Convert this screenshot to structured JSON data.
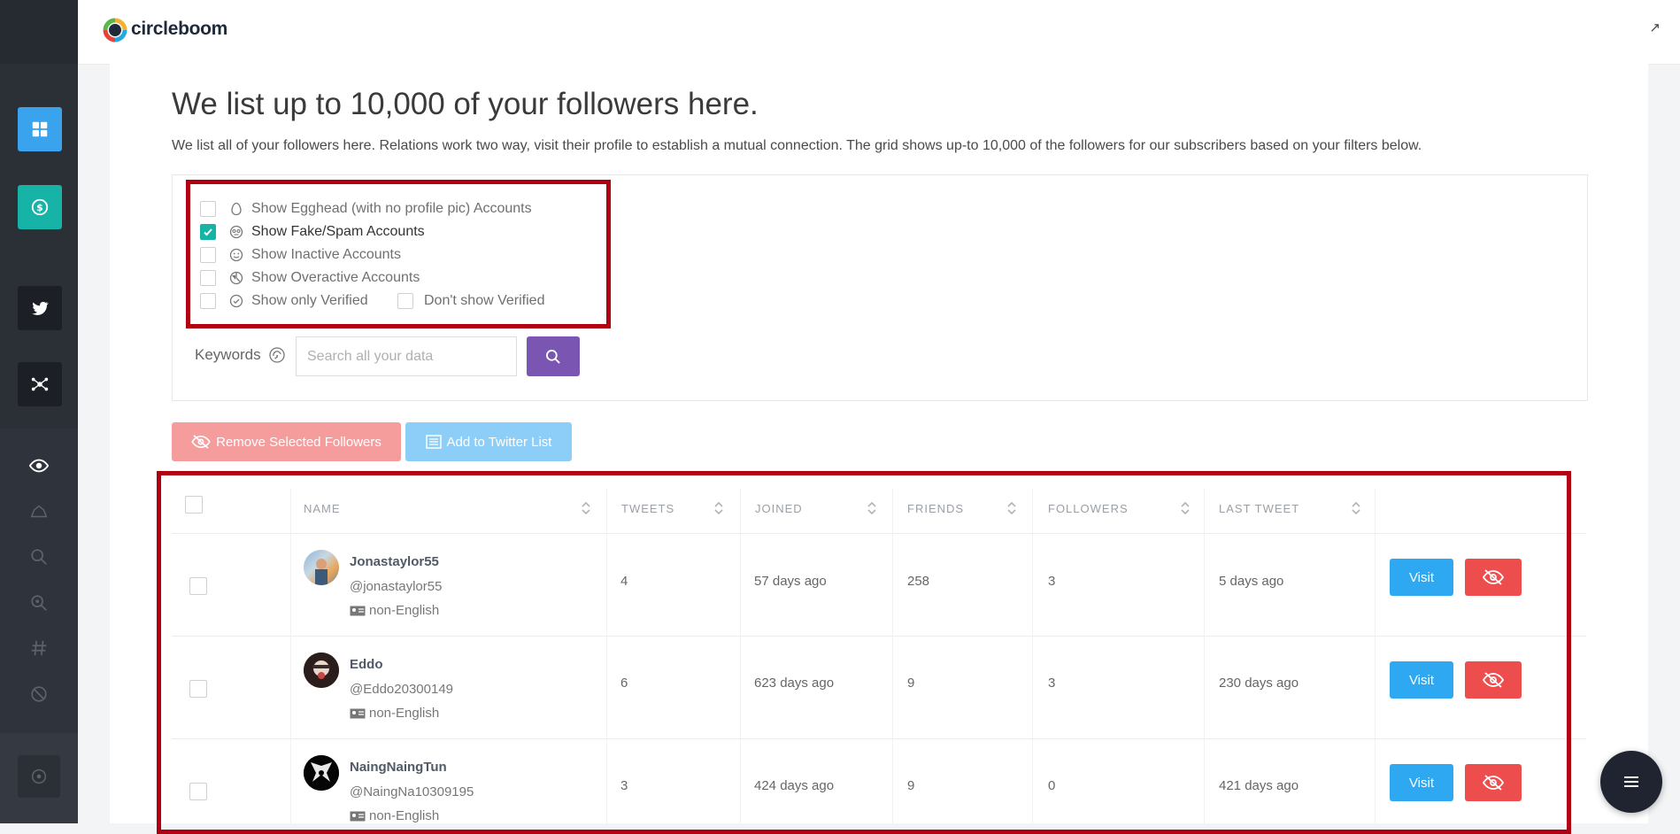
{
  "brand": {
    "logo_text": "circleboom"
  },
  "page": {
    "title": "We list up to 10,000 of your followers here.",
    "subtitle": "We list all of your followers here. Relations work two way, visit their profile to establish a mutual connection. The grid shows up-to 10,000 of the followers for our subscribers based on your filters below."
  },
  "filters": {
    "egghead": {
      "label": "Show Egghead (with no profile pic) Accounts",
      "checked": false
    },
    "fake_spam": {
      "label": "Show Fake/Spam Accounts",
      "checked": true
    },
    "inactive": {
      "label": "Show Inactive Accounts",
      "checked": false
    },
    "overactive": {
      "label": "Show Overactive Accounts",
      "checked": false
    },
    "only_verified": {
      "label": "Show only Verified",
      "checked": false
    },
    "dont_verified": {
      "label": "Don't show Verified",
      "checked": false
    }
  },
  "search": {
    "label": "Keywords",
    "placeholder": "Search all your data"
  },
  "actions": {
    "remove_label": "Remove Selected Followers",
    "add_list_label": "Add to Twitter List"
  },
  "table": {
    "columns": [
      "NAME",
      "TWEETS",
      "JOINED",
      "FRIENDS",
      "FOLLOWERS",
      "LAST TWEET"
    ],
    "rows": [
      {
        "name": "Jonastaylor55",
        "handle": "@jonastaylor55",
        "lang": "non-English",
        "tweets": "4",
        "joined": "57 days ago",
        "friends": "258",
        "followers": "3",
        "last_tweet": "5 days ago",
        "visit": "Visit"
      },
      {
        "name": "Eddo",
        "handle": "@Eddo20300149",
        "lang": "non-English",
        "tweets": "6",
        "joined": "623 days ago",
        "friends": "9",
        "followers": "3",
        "last_tweet": "230 days ago",
        "visit": "Visit"
      },
      {
        "name": "NaingNaingTun",
        "handle": "@NaingNa10309195",
        "lang": "non-English",
        "tweets": "3",
        "joined": "424 days ago",
        "friends": "9",
        "followers": "0",
        "last_tweet": "421 days ago",
        "visit": "Visit"
      }
    ]
  },
  "colors": {
    "accent_teal": "#17b3a6",
    "accent_blue": "#2ea8f0",
    "danger": "#ee4d4d",
    "highlight_frame": "#b00012",
    "purple": "#7a55b2"
  },
  "icons": [
    "dashboard-icon",
    "dollar-icon",
    "twitter-icon",
    "network-icon",
    "eye-icon",
    "home-icon",
    "search-icon",
    "search-location-icon",
    "hashtag-icon",
    "block-icon",
    "circle-dot-icon",
    "menu-icon"
  ]
}
